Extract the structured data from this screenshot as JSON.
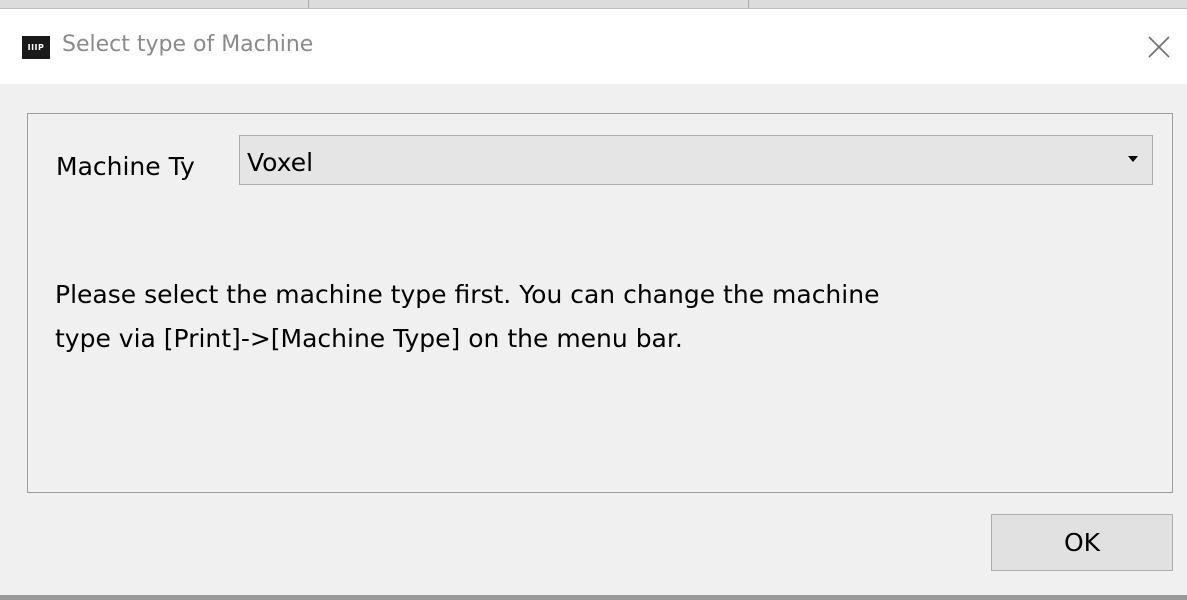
{
  "window": {
    "app_icon_text": "IIIP",
    "title": "Select type of Machine"
  },
  "form": {
    "machine_type_label": "Machine Ty",
    "machine_type_value": "Voxel"
  },
  "message": {
    "line1": "Please select the machine type first. You can change the machine",
    "line2": "type via [Print]->[Machine Type] on the menu bar."
  },
  "buttons": {
    "ok_label": "OK"
  },
  "icons": {
    "app": "app-logo-icon",
    "close": "close-icon",
    "dropdown": "chevron-down-icon"
  }
}
